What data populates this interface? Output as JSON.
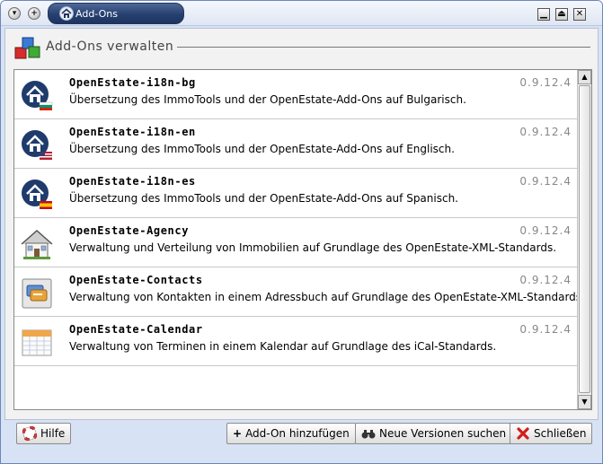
{
  "window": {
    "title": "Add-Ons"
  },
  "heading": {
    "title": "Add-Ons verwalten"
  },
  "addons": [
    {
      "name": "OpenEstate-i18n-bg",
      "version": "0.9.12.4",
      "description": "Übersetzung des ImmoTools und der OpenEstate-Add-Ons auf Bulgarisch.",
      "icon": "home-bg-flag-icon"
    },
    {
      "name": "OpenEstate-i18n-en",
      "version": "0.9.12.4",
      "description": "Übersetzung des ImmoTools und der OpenEstate-Add-Ons auf Englisch.",
      "icon": "home-us-flag-icon"
    },
    {
      "name": "OpenEstate-i18n-es",
      "version": "0.9.12.4",
      "description": "Übersetzung des ImmoTools und der OpenEstate-Add-Ons auf Spanisch.",
      "icon": "home-es-flag-icon"
    },
    {
      "name": "OpenEstate-Agency",
      "version": "0.9.12.4",
      "description": "Verwaltung und Verteilung von Immobilien auf Grundlage des OpenEstate-XML-Standards.",
      "icon": "house-icon"
    },
    {
      "name": "OpenEstate-Contacts",
      "version": "0.9.12.4",
      "description": "Verwaltung von Kontakten in einem Adressbuch auf Grundlage des OpenEstate-XML-Standards.",
      "icon": "address-book-icon"
    },
    {
      "name": "OpenEstate-Calendar",
      "version": "0.9.12.4",
      "description": "Verwaltung von Terminen in einem Kalendar auf Grundlage des iCal-Standards.",
      "icon": "calendar-icon"
    }
  ],
  "footer": {
    "help_label": "Hilfe",
    "add_label": "Add-On hinzufügen",
    "search_label": "Neue Versionen suchen",
    "close_label": "Schließen"
  },
  "colors": {
    "title_tab": "#26406f",
    "window_frame": "#6b86b8",
    "version_text": "#888888"
  }
}
